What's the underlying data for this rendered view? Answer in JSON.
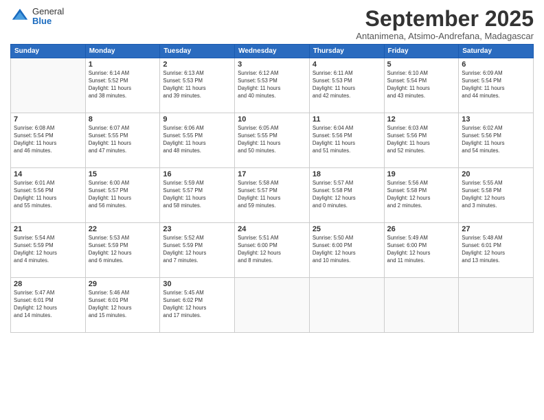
{
  "logo": {
    "general": "General",
    "blue": "Blue"
  },
  "title": "September 2025",
  "subtitle": "Antanimena, Atsimo-Andrefana, Madagascar",
  "weekdays": [
    "Sunday",
    "Monday",
    "Tuesday",
    "Wednesday",
    "Thursday",
    "Friday",
    "Saturday"
  ],
  "weeks": [
    [
      {
        "day": "",
        "info": ""
      },
      {
        "day": "1",
        "info": "Sunrise: 6:14 AM\nSunset: 5:52 PM\nDaylight: 11 hours\nand 38 minutes."
      },
      {
        "day": "2",
        "info": "Sunrise: 6:13 AM\nSunset: 5:53 PM\nDaylight: 11 hours\nand 39 minutes."
      },
      {
        "day": "3",
        "info": "Sunrise: 6:12 AM\nSunset: 5:53 PM\nDaylight: 11 hours\nand 40 minutes."
      },
      {
        "day": "4",
        "info": "Sunrise: 6:11 AM\nSunset: 5:53 PM\nDaylight: 11 hours\nand 42 minutes."
      },
      {
        "day": "5",
        "info": "Sunrise: 6:10 AM\nSunset: 5:54 PM\nDaylight: 11 hours\nand 43 minutes."
      },
      {
        "day": "6",
        "info": "Sunrise: 6:09 AM\nSunset: 5:54 PM\nDaylight: 11 hours\nand 44 minutes."
      }
    ],
    [
      {
        "day": "7",
        "info": "Sunrise: 6:08 AM\nSunset: 5:54 PM\nDaylight: 11 hours\nand 46 minutes."
      },
      {
        "day": "8",
        "info": "Sunrise: 6:07 AM\nSunset: 5:55 PM\nDaylight: 11 hours\nand 47 minutes."
      },
      {
        "day": "9",
        "info": "Sunrise: 6:06 AM\nSunset: 5:55 PM\nDaylight: 11 hours\nand 48 minutes."
      },
      {
        "day": "10",
        "info": "Sunrise: 6:05 AM\nSunset: 5:55 PM\nDaylight: 11 hours\nand 50 minutes."
      },
      {
        "day": "11",
        "info": "Sunrise: 6:04 AM\nSunset: 5:56 PM\nDaylight: 11 hours\nand 51 minutes."
      },
      {
        "day": "12",
        "info": "Sunrise: 6:03 AM\nSunset: 5:56 PM\nDaylight: 11 hours\nand 52 minutes."
      },
      {
        "day": "13",
        "info": "Sunrise: 6:02 AM\nSunset: 5:56 PM\nDaylight: 11 hours\nand 54 minutes."
      }
    ],
    [
      {
        "day": "14",
        "info": "Sunrise: 6:01 AM\nSunset: 5:56 PM\nDaylight: 11 hours\nand 55 minutes."
      },
      {
        "day": "15",
        "info": "Sunrise: 6:00 AM\nSunset: 5:57 PM\nDaylight: 11 hours\nand 56 minutes."
      },
      {
        "day": "16",
        "info": "Sunrise: 5:59 AM\nSunset: 5:57 PM\nDaylight: 11 hours\nand 58 minutes."
      },
      {
        "day": "17",
        "info": "Sunrise: 5:58 AM\nSunset: 5:57 PM\nDaylight: 11 hours\nand 59 minutes."
      },
      {
        "day": "18",
        "info": "Sunrise: 5:57 AM\nSunset: 5:58 PM\nDaylight: 12 hours\nand 0 minutes."
      },
      {
        "day": "19",
        "info": "Sunrise: 5:56 AM\nSunset: 5:58 PM\nDaylight: 12 hours\nand 2 minutes."
      },
      {
        "day": "20",
        "info": "Sunrise: 5:55 AM\nSunset: 5:58 PM\nDaylight: 12 hours\nand 3 minutes."
      }
    ],
    [
      {
        "day": "21",
        "info": "Sunrise: 5:54 AM\nSunset: 5:59 PM\nDaylight: 12 hours\nand 4 minutes."
      },
      {
        "day": "22",
        "info": "Sunrise: 5:53 AM\nSunset: 5:59 PM\nDaylight: 12 hours\nand 6 minutes."
      },
      {
        "day": "23",
        "info": "Sunrise: 5:52 AM\nSunset: 5:59 PM\nDaylight: 12 hours\nand 7 minutes."
      },
      {
        "day": "24",
        "info": "Sunrise: 5:51 AM\nSunset: 6:00 PM\nDaylight: 12 hours\nand 8 minutes."
      },
      {
        "day": "25",
        "info": "Sunrise: 5:50 AM\nSunset: 6:00 PM\nDaylight: 12 hours\nand 10 minutes."
      },
      {
        "day": "26",
        "info": "Sunrise: 5:49 AM\nSunset: 6:00 PM\nDaylight: 12 hours\nand 11 minutes."
      },
      {
        "day": "27",
        "info": "Sunrise: 5:48 AM\nSunset: 6:01 PM\nDaylight: 12 hours\nand 13 minutes."
      }
    ],
    [
      {
        "day": "28",
        "info": "Sunrise: 5:47 AM\nSunset: 6:01 PM\nDaylight: 12 hours\nand 14 minutes."
      },
      {
        "day": "29",
        "info": "Sunrise: 5:46 AM\nSunset: 6:01 PM\nDaylight: 12 hours\nand 15 minutes."
      },
      {
        "day": "30",
        "info": "Sunrise: 5:45 AM\nSunset: 6:02 PM\nDaylight: 12 hours\nand 17 minutes."
      },
      {
        "day": "",
        "info": ""
      },
      {
        "day": "",
        "info": ""
      },
      {
        "day": "",
        "info": ""
      },
      {
        "day": "",
        "info": ""
      }
    ]
  ]
}
